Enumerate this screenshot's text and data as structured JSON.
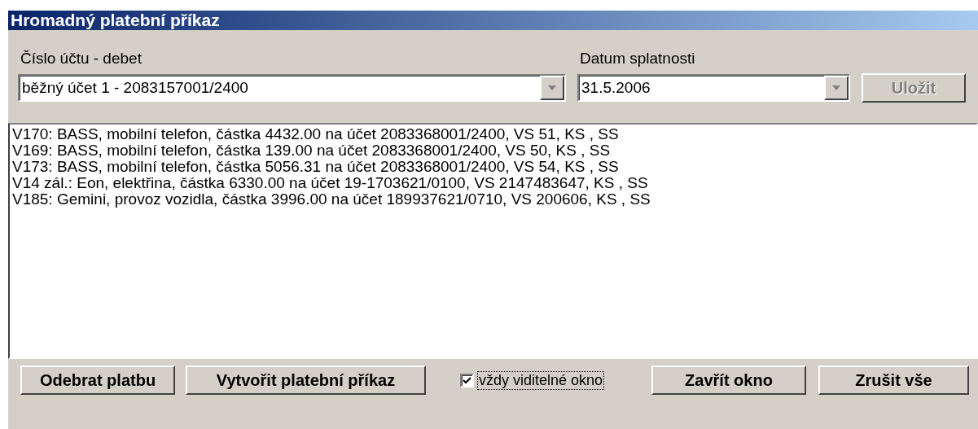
{
  "window": {
    "title": "Hromadný platební příkaz"
  },
  "account": {
    "label": "Číslo účtu - debet",
    "value": "běžný účet 1 - 2083157001/2400"
  },
  "due_date": {
    "label": "Datum splatnosti",
    "value": "31.5.2006"
  },
  "save_button": {
    "label": "Uložit",
    "disabled": true
  },
  "payments": [
    {
      "text": "V170: BASS, mobilní telefon, částka 4432.00 na účet 2083368001/2400, VS 51, KS , SS"
    },
    {
      "text": "V169: BASS, mobilní telefon, částka 139.00 na účet 2083368001/2400, VS 50, KS , SS"
    },
    {
      "text": "V173: BASS, mobilní telefon, částka 5056.31 na účet 2083368001/2400, VS 54, KS , SS"
    },
    {
      "text": "V14 zál.: Eon, elektřina, částka 6330.00 na účet 19-1703621/0100, VS 2147483647, KS , SS"
    },
    {
      "text": "V185: Gemini, provoz vozidla, částka 3996.00 na účet 189937621/0710, VS 200606, KS , SS"
    }
  ],
  "left_buttons": [
    {
      "label": "Odebrat platbu",
      "disabled": false
    },
    {
      "label": "Vytvořit platební příkaz",
      "disabled": false
    }
  ],
  "always_visible": {
    "label": "vždy viditelné okno",
    "checked": true
  },
  "right_buttons": [
    {
      "label": "Zavřít okno",
      "disabled": false
    },
    {
      "label": "Zrušit vše",
      "disabled": false
    }
  ]
}
